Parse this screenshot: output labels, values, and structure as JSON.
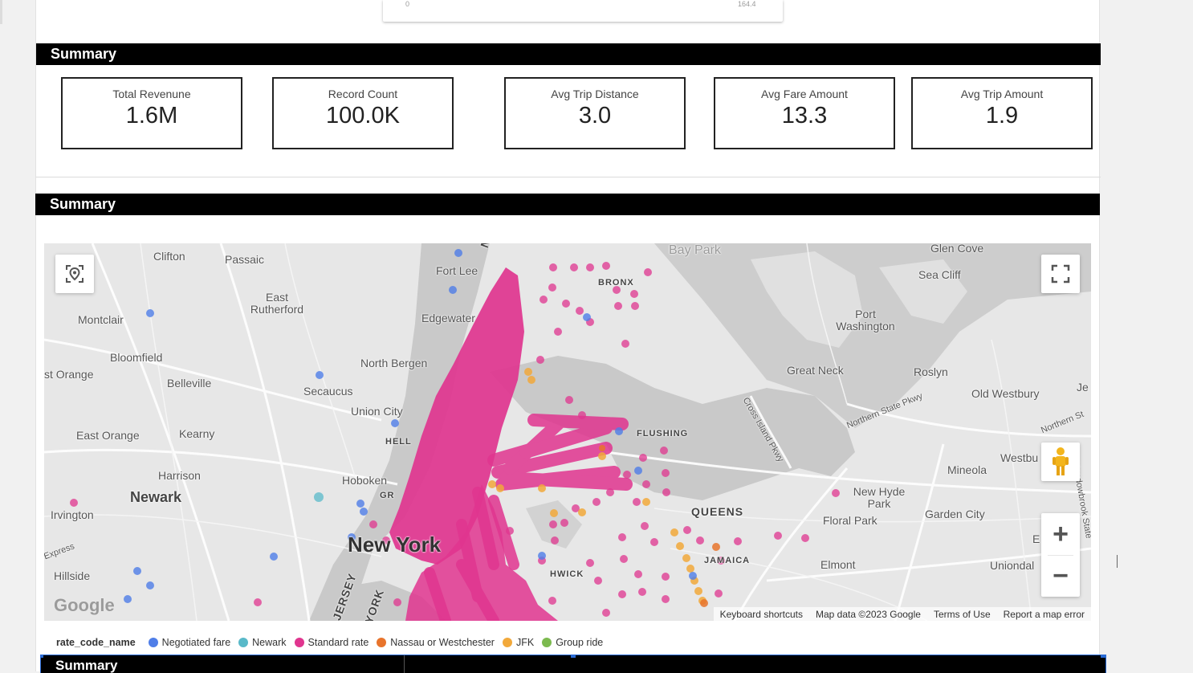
{
  "top_card": {
    "tick_left": "0",
    "tick_right": "164.4"
  },
  "summary_title_1": "Summary",
  "kpis": [
    {
      "label": "Total Revenune",
      "value": "1.6M"
    },
    {
      "label": "Record Count",
      "value": "100.0K"
    },
    {
      "label": "Avg Trip Distance",
      "value": "3.0"
    },
    {
      "label": "Avg Fare Amount",
      "value": "13.3"
    },
    {
      "label": "Avg Trip Amount",
      "value": "1.9"
    }
  ],
  "summary_title_2": "Summary",
  "summary_title_3": "Summary",
  "map": {
    "places": [
      "Clifton",
      "Passaic",
      "Fort Lee",
      "Bay Park",
      "Glen Cove",
      "Sea Cliff",
      "BRONX",
      "East Rutherford",
      "Montclair",
      "Edgewater",
      "Port Washington",
      "Bloomfield",
      "North Bergen",
      "Great Neck",
      "Roslyn",
      "st Orange",
      "Belleville",
      "Secaucus",
      "Old Westbury",
      "Je",
      "Union City",
      "East Orange",
      "Kearny",
      "HELL",
      "FLUSHING",
      "Northern State Pkwy",
      "Cross Island Pkwy",
      "Harrison",
      "Hoboken",
      "Mineola",
      "Westbu",
      "Newark",
      "QUEENS",
      "New Hyde Park",
      "Garden City",
      "Irvington",
      "Floral Park",
      "New York",
      "JAMAICA",
      "Elmont",
      "Uniondal",
      "Hillside",
      "Express",
      "JERSEY",
      "YORK",
      "Northern St",
      "Meadowbrook State",
      "GR",
      "HWICK",
      "E",
      "NE"
    ],
    "attribution": [
      "Keyboard shortcuts",
      "Map data ©2023 Google",
      "Terms of Use",
      "Report a map error"
    ],
    "logo_text": "Google",
    "zoom_in": "+",
    "zoom_out": "−",
    "icons": {
      "locate": "location-target-icon",
      "fullscreen": "fullscreen-icon",
      "pegman": "street-view-pegman-icon"
    }
  },
  "legend": {
    "title": "rate_code_name",
    "items": [
      {
        "label": "Negotiated fare",
        "color": "#4f7ee8"
      },
      {
        "label": "Newark",
        "color": "#59b9c9"
      },
      {
        "label": "Standard rate",
        "color": "#e0358f"
      },
      {
        "label": "Nassau or Westchester",
        "color": "#e8742c"
      },
      {
        "label": "JFK",
        "color": "#f2a93b"
      },
      {
        "label": "Group ride",
        "color": "#7cba4f"
      }
    ]
  }
}
